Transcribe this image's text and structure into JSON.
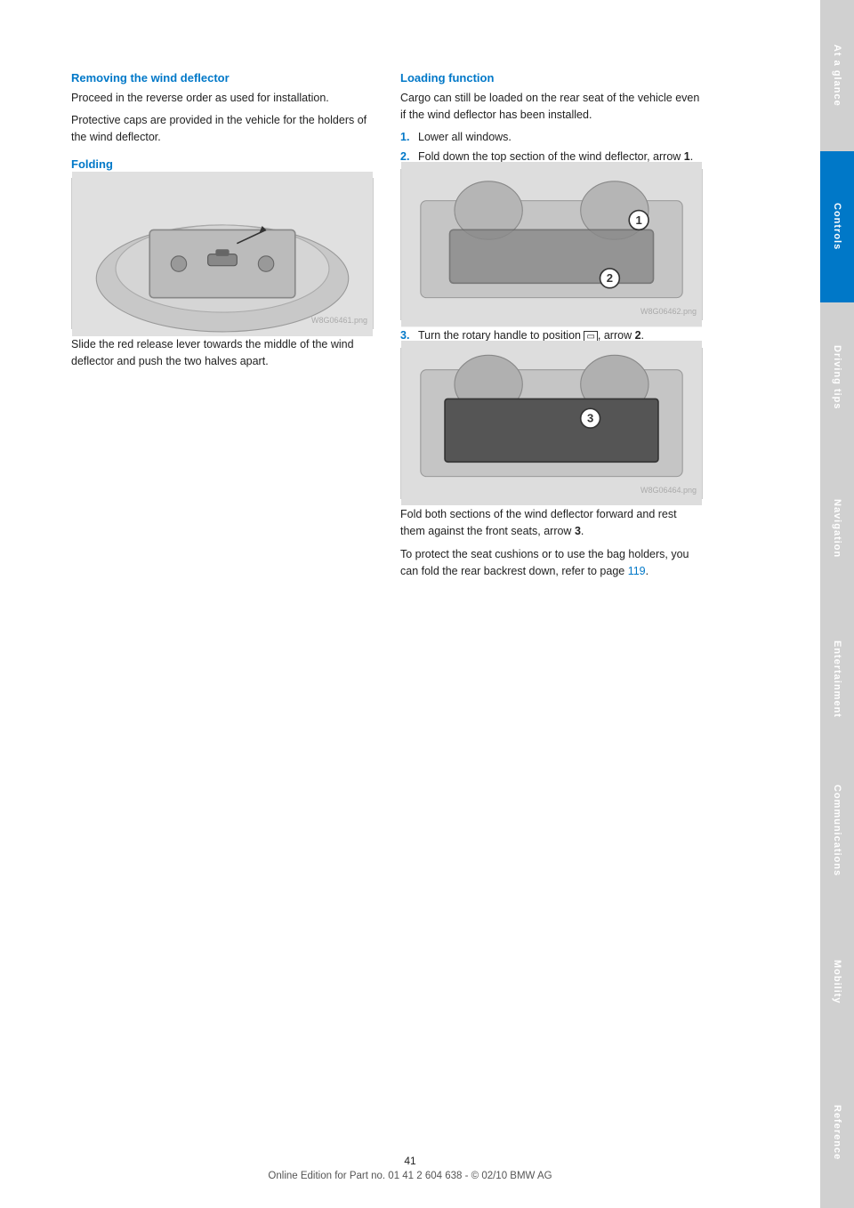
{
  "sidebar": {
    "tabs": [
      {
        "label": "At a glance",
        "state": "light"
      },
      {
        "label": "Controls",
        "state": "active"
      },
      {
        "label": "Driving tips",
        "state": "light"
      },
      {
        "label": "Navigation",
        "state": "light"
      },
      {
        "label": "Entertainment",
        "state": "light"
      },
      {
        "label": "Communications",
        "state": "light"
      },
      {
        "label": "Mobility",
        "state": "light"
      },
      {
        "label": "Reference",
        "state": "light"
      }
    ]
  },
  "left": {
    "section_heading": "Removing the wind deflector",
    "para1": "Proceed in the reverse order as used for installation.",
    "para2": "Protective caps are provided in the vehicle for the holders of the wind deflector.",
    "sub_heading": "Folding",
    "caption": "Slide the red release lever towards the middle of the wind deflector and push the two halves apart.",
    "watermark1": "W8G06461.png"
  },
  "right": {
    "section_heading": "Loading function",
    "intro": "Cargo can still be loaded on the rear seat of the vehicle even if the wind deflector has been installed.",
    "step1": "Lower all windows.",
    "step2_prefix": "Fold down the top section of the wind deflector, arrow ",
    "step2_arrow": "1",
    "step2_suffix": ".",
    "step3_prefix": "Turn the rotary handle to position ",
    "step3_icon": "▭",
    "step3_middle": ", arrow ",
    "step3_arrow": "2",
    "step3_suffix": ".",
    "caption1_prefix": "Fold both sections of the wind deflector forward and rest them against the front seats, arrow ",
    "caption1_arrow": "3",
    "caption1_suffix": ".",
    "caption2_prefix": "To protect the seat cushions or to use the bag holders, you can fold the rear backrest down, refer to page ",
    "caption2_link": "119",
    "caption2_suffix": ".",
    "watermark2": "W8G06462.png",
    "watermark3": "W8G06464.png"
  },
  "footer": {
    "page_number": "41",
    "copyright": "Online Edition for Part no. 01 41 2 604 638 - © 02/10 BMW AG"
  }
}
